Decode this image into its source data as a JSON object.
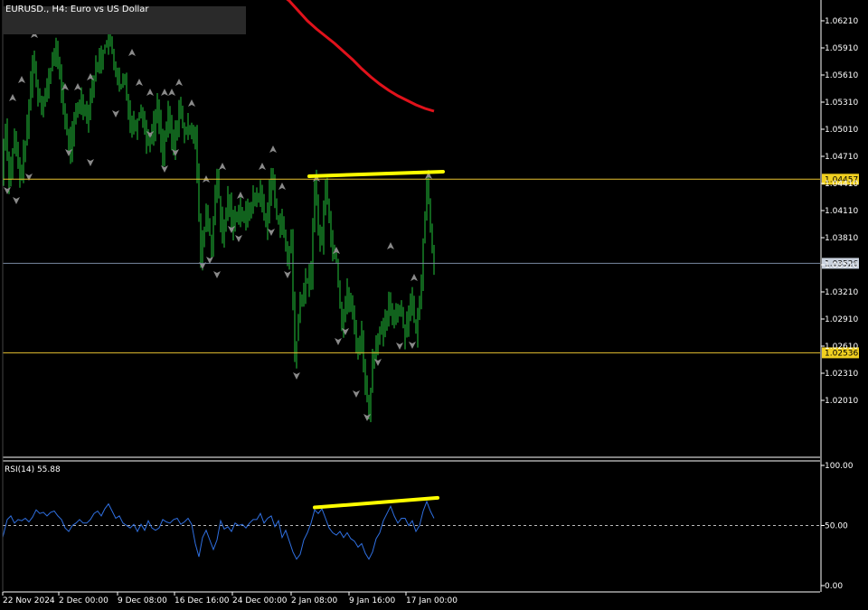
{
  "header": {
    "symbol_label": "EURUSD., H4:  Euro vs US Dollar",
    "rsi_label": "RSI(14) 55.88"
  },
  "colors": {
    "background": "#000000",
    "candle": "#22c33a",
    "ma": "#e0121b",
    "fractal": "#8a8a8a",
    "trendline": "#ffff00",
    "hline_level": "#e8c230",
    "hline_current": "#7888a0",
    "rsi": "#2f6fe0",
    "axis": "#ffffff",
    "price_tag_level_bg": "#f0d020",
    "price_tag_current_bg": "#c8d0dc"
  },
  "chart_data": [
    {
      "type": "candlestick",
      "symbol": "EURUSD.",
      "timeframe": "H4",
      "title": "EURUSD., H4:  Euro vs US Dollar",
      "y_ticks": [
        "1.06210",
        "1.05910",
        "1.05610",
        "1.05310",
        "1.05010",
        "1.04710",
        "1.04410",
        "1.04110",
        "1.03810",
        "1.03510",
        "1.03210",
        "1.02910",
        "1.02610",
        "1.02310",
        "1.02010"
      ],
      "ylim": [
        1.0186,
        1.0643
      ],
      "x_ticks": [
        "22 Nov 2024",
        "2 Dec 00:00",
        "9 Dec 08:00",
        "16 Dec 16:00",
        "24 Dec 00:00",
        "2 Jan 08:00",
        "9 Jan 16:00",
        "17 Jan 00:00"
      ],
      "price_path": [
        [
          0,
          1.0405
        ],
        [
          3,
          1.047
        ],
        [
          6,
          1.0505
        ],
        [
          10,
          1.0445
        ],
        [
          16,
          1.049
        ],
        [
          22,
          1.0445
        ],
        [
          30,
          1.05
        ],
        [
          36,
          1.058
        ],
        [
          42,
          1.054
        ],
        [
          48,
          1.053
        ],
        [
          54,
          1.0555
        ],
        [
          60,
          1.059
        ],
        [
          66,
          1.0565
        ],
        [
          72,
          1.0505
        ],
        [
          78,
          1.048
        ],
        [
          84,
          1.052
        ],
        [
          90,
          1.0535
        ],
        [
          96,
          1.0515
        ],
        [
          102,
          1.055
        ],
        [
          108,
          1.0575
        ],
        [
          114,
          1.0585
        ],
        [
          120,
          1.0605
        ],
        [
          126,
          1.0575
        ],
        [
          132,
          1.0545
        ],
        [
          138,
          1.0555
        ],
        [
          144,
          1.051
        ],
        [
          150,
          1.0505
        ],
        [
          156,
          1.0525
        ],
        [
          162,
          1.049
        ],
        [
          168,
          1.0495
        ],
        [
          174,
          1.0525
        ],
        [
          180,
          1.0475
        ],
        [
          186,
          1.0515
        ],
        [
          192,
          1.048
        ],
        [
          198,
          1.0525
        ],
        [
          204,
          1.0495
        ],
        [
          210,
          1.0505
        ],
        [
          216,
          1.0495
        ],
        [
          222,
          1.0355
        ],
        [
          228,
          1.041
        ],
        [
          234,
          1.037
        ],
        [
          240,
          1.045
        ],
        [
          246,
          1.0375
        ],
        [
          252,
          1.0425
        ],
        [
          258,
          1.0395
        ],
        [
          264,
          1.0415
        ],
        [
          270,
          1.04
        ],
        [
          276,
          1.0415
        ],
        [
          282,
          1.0425
        ],
        [
          288,
          1.043
        ],
        [
          294,
          1.0395
        ],
        [
          300,
          1.045
        ],
        [
          306,
          1.0405
        ],
        [
          312,
          1.0395
        ],
        [
          318,
          1.0355
        ],
        [
          322,
          1.038
        ],
        [
          326,
          1.0245
        ],
        [
          332,
          1.031
        ],
        [
          338,
          1.033
        ],
        [
          344,
          1.034
        ],
        [
          348,
          1.0445
        ],
        [
          352,
          1.039
        ],
        [
          356,
          1.0375
        ],
        [
          360,
          1.0445
        ],
        [
          366,
          1.038
        ],
        [
          372,
          1.0355
        ],
        [
          378,
          1.0285
        ],
        [
          384,
          1.032
        ],
        [
          390,
          1.0295
        ],
        [
          396,
          1.0255
        ],
        [
          400,
          1.0275
        ],
        [
          404,
          1.0215
        ],
        [
          408,
          1.0185
        ],
        [
          412,
          1.0245
        ],
        [
          418,
          1.0275
        ],
        [
          424,
          1.0275
        ],
        [
          430,
          1.0305
        ],
        [
          436,
          1.0295
        ],
        [
          442,
          1.0305
        ],
        [
          448,
          1.0275
        ],
        [
          454,
          1.0315
        ],
        [
          460,
          1.0275
        ],
        [
          464,
          1.0305
        ],
        [
          468,
          1.0375
        ],
        [
          472,
          1.0445
        ],
        [
          476,
          1.0395
        ],
        [
          480,
          1.035
        ]
      ],
      "moving_average": [
        [
          310,
          1.0651
        ],
        [
          320,
          1.0643
        ],
        [
          330,
          1.0632
        ],
        [
          340,
          1.0621
        ],
        [
          350,
          1.0612
        ],
        [
          360,
          1.0604
        ],
        [
          370,
          1.0596
        ],
        [
          380,
          1.0587
        ],
        [
          390,
          1.0578
        ],
        [
          400,
          1.0568
        ],
        [
          410,
          1.0559
        ],
        [
          420,
          1.0551
        ],
        [
          430,
          1.0544
        ],
        [
          440,
          1.0538
        ],
        [
          450,
          1.0533
        ],
        [
          460,
          1.0528
        ],
        [
          470,
          1.0524
        ],
        [
          480,
          1.0521
        ]
      ],
      "fractals_up": [
        [
          14,
          1.0535
        ],
        [
          24,
          1.0555
        ],
        [
          38,
          1.0605
        ],
        [
          58,
          1.0609
        ],
        [
          72,
          1.0547
        ],
        [
          86,
          1.0547
        ],
        [
          100,
          1.0558
        ],
        [
          116,
          1.0611
        ],
        [
          132,
          1.0611
        ],
        [
          146,
          1.0585
        ],
        [
          154,
          1.0552
        ],
        [
          166,
          1.0541
        ],
        [
          182,
          1.0541
        ],
        [
          190,
          1.0541
        ],
        [
          198,
          1.0552
        ],
        [
          212,
          1.0529
        ],
        [
          228,
          1.0445
        ],
        [
          246,
          1.0459
        ],
        [
          266,
          1.0427
        ],
        [
          290,
          1.0459
        ],
        [
          302,
          1.0478
        ],
        [
          312,
          1.0437
        ],
        [
          350,
          1.0446
        ],
        [
          372,
          1.0366
        ],
        [
          432,
          1.0371
        ],
        [
          458,
          1.0336
        ],
        [
          474,
          1.0449
        ]
      ],
      "fractals_down": [
        [
          8,
          1.0434
        ],
        [
          18,
          1.0423
        ],
        [
          32,
          1.0449
        ],
        [
          76,
          1.0476
        ],
        [
          100,
          1.0465
        ],
        [
          128,
          1.0519
        ],
        [
          166,
          1.0496
        ],
        [
          182,
          1.0458
        ],
        [
          194,
          1.0476
        ],
        [
          224,
          1.0351
        ],
        [
          232,
          1.0357
        ],
        [
          240,
          1.0341
        ],
        [
          256,
          1.0391
        ],
        [
          264,
          1.0381
        ],
        [
          300,
          1.0388
        ],
        [
          318,
          1.0341
        ],
        [
          328,
          1.0229
        ],
        [
          374,
          1.0267
        ],
        [
          382,
          1.0278
        ],
        [
          394,
          1.0209
        ],
        [
          406,
          1.0183
        ],
        [
          418,
          1.0244
        ],
        [
          442,
          1.0262
        ],
        [
          456,
          1.0263
        ]
      ],
      "horizontal_levels": [
        {
          "price": "1.04457",
          "kind": "level"
        },
        {
          "price": "1.03526",
          "kind": "current"
        },
        {
          "price": "1.02536",
          "kind": "level"
        }
      ],
      "trendline": {
        "x": [
          342,
          490
        ],
        "y": [
          1.0449,
          1.0454
        ]
      }
    },
    {
      "type": "line",
      "name": "RSI(14)",
      "current": 55.88,
      "ylim": [
        0,
        100
      ],
      "y_ticks": [
        "100.00",
        "50.00",
        "0.00"
      ],
      "level_line": 50,
      "values": [
        [
          3,
          40
        ],
        [
          8,
          55
        ],
        [
          12,
          58
        ],
        [
          16,
          52
        ],
        [
          20,
          55
        ],
        [
          24,
          54
        ],
        [
          28,
          56
        ],
        [
          32,
          53
        ],
        [
          36,
          57
        ],
        [
          40,
          63
        ],
        [
          44,
          60
        ],
        [
          48,
          61
        ],
        [
          52,
          58
        ],
        [
          56,
          61
        ],
        [
          60,
          62
        ],
        [
          64,
          58
        ],
        [
          68,
          55
        ],
        [
          72,
          48
        ],
        [
          76,
          45
        ],
        [
          80,
          50
        ],
        [
          84,
          52
        ],
        [
          88,
          55
        ],
        [
          92,
          52
        ],
        [
          96,
          52
        ],
        [
          100,
          55
        ],
        [
          104,
          60
        ],
        [
          108,
          62
        ],
        [
          112,
          58
        ],
        [
          116,
          64
        ],
        [
          120,
          68
        ],
        [
          124,
          62
        ],
        [
          128,
          56
        ],
        [
          132,
          58
        ],
        [
          136,
          52
        ],
        [
          140,
          50
        ],
        [
          144,
          48
        ],
        [
          148,
          51
        ],
        [
          152,
          45
        ],
        [
          156,
          51
        ],
        [
          160,
          46
        ],
        [
          164,
          54
        ],
        [
          168,
          48
        ],
        [
          172,
          46
        ],
        [
          176,
          48
        ],
        [
          180,
          55
        ],
        [
          184,
          53
        ],
        [
          188,
          52
        ],
        [
          192,
          55
        ],
        [
          196,
          56
        ],
        [
          200,
          51
        ],
        [
          204,
          53
        ],
        [
          208,
          56
        ],
        [
          212,
          51
        ],
        [
          216,
          35
        ],
        [
          220,
          24
        ],
        [
          224,
          40
        ],
        [
          228,
          46
        ],
        [
          232,
          38
        ],
        [
          236,
          30
        ],
        [
          240,
          38
        ],
        [
          244,
          54
        ],
        [
          248,
          47
        ],
        [
          252,
          49
        ],
        [
          256,
          45
        ],
        [
          260,
          52
        ],
        [
          264,
          50
        ],
        [
          268,
          51
        ],
        [
          272,
          48
        ],
        [
          276,
          52
        ],
        [
          280,
          55
        ],
        [
          284,
          55
        ],
        [
          288,
          60
        ],
        [
          292,
          52
        ],
        [
          296,
          56
        ],
        [
          300,
          58
        ],
        [
          304,
          49
        ],
        [
          308,
          54
        ],
        [
          312,
          40
        ],
        [
          316,
          46
        ],
        [
          320,
          37
        ],
        [
          324,
          28
        ],
        [
          328,
          22
        ],
        [
          332,
          26
        ],
        [
          336,
          38
        ],
        [
          340,
          44
        ],
        [
          344,
          52
        ],
        [
          348,
          63
        ],
        [
          352,
          60
        ],
        [
          356,
          64
        ],
        [
          360,
          56
        ],
        [
          364,
          48
        ],
        [
          368,
          44
        ],
        [
          372,
          42
        ],
        [
          376,
          45
        ],
        [
          380,
          40
        ],
        [
          384,
          44
        ],
        [
          388,
          39
        ],
        [
          392,
          37
        ],
        [
          396,
          32
        ],
        [
          400,
          35
        ],
        [
          404,
          27
        ],
        [
          408,
          22
        ],
        [
          412,
          28
        ],
        [
          416,
          39
        ],
        [
          420,
          44
        ],
        [
          424,
          54
        ],
        [
          428,
          60
        ],
        [
          432,
          66
        ],
        [
          436,
          58
        ],
        [
          440,
          52
        ],
        [
          444,
          56
        ],
        [
          448,
          56
        ],
        [
          452,
          50
        ],
        [
          456,
          54
        ],
        [
          460,
          45
        ],
        [
          464,
          50
        ],
        [
          468,
          62
        ],
        [
          472,
          70
        ],
        [
          476,
          62
        ],
        [
          480,
          56
        ]
      ],
      "trendline": {
        "x": [
          348,
          484
        ],
        "y": [
          65,
          73
        ]
      }
    }
  ]
}
